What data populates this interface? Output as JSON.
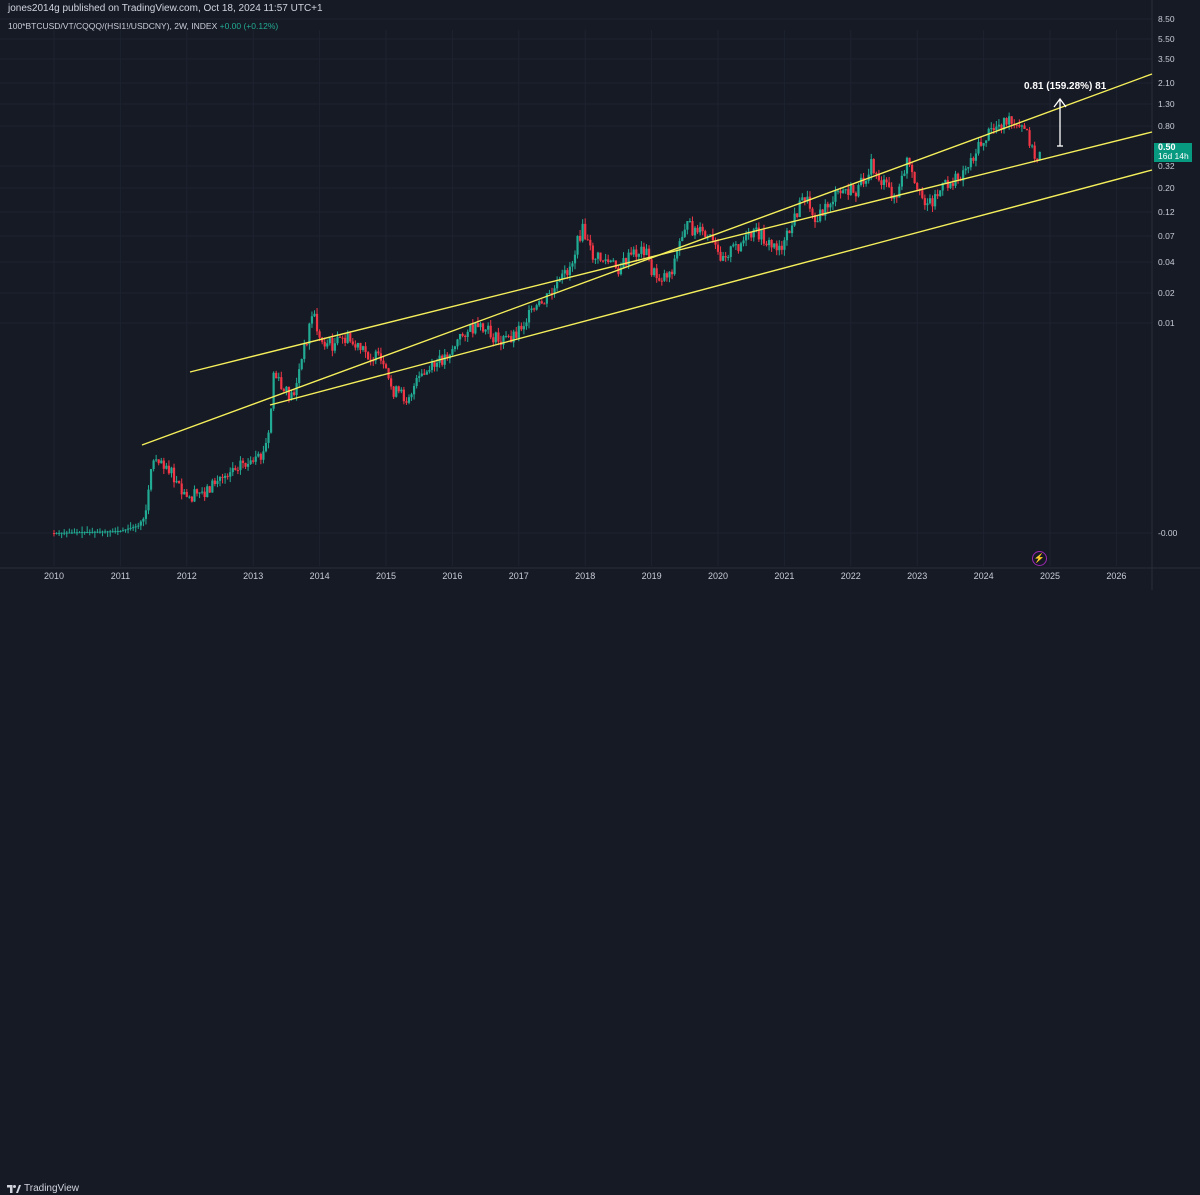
{
  "header": {
    "publisher": "jones2014g published on TradingView.com, Oct 18, 2024 11:57 UTC+1",
    "symbol": "100*BTCUSD/VT/CQQQ/(HSI1!/USDCNY), 2W, INDEX",
    "change": "+0.00 (+0.12%)"
  },
  "price_tag": {
    "price": "0.50",
    "countdown": "16d 14h"
  },
  "annotation": {
    "text": "0.81 (159.28%) 81"
  },
  "footer": {
    "brand": "TradingView"
  },
  "icons": {
    "flash": "lightning-icon",
    "logo": "tradingview-logo-icon"
  },
  "colors": {
    "up": "#22ab94",
    "down": "#f23645",
    "channel": "#f5ef5b",
    "background": "#161a25",
    "price_tag": "#089981"
  },
  "chart_data": {
    "type": "candlestick",
    "title": "100*BTCUSD/VT/CQQQ/(HSI1!/USDCNY), 2W, INDEX",
    "x_ticks": [
      "2010",
      "2011",
      "2012",
      "2013",
      "2014",
      "2015",
      "2016",
      "2017",
      "2018",
      "2019",
      "2020",
      "2021",
      "2022",
      "2023",
      "2024",
      "2025",
      "2026"
    ],
    "y_ticks": [
      "8.50",
      "5.50",
      "3.50",
      "2.10",
      "1.30",
      "0.80",
      "0.32",
      "0.20",
      "0.12",
      "0.07",
      "0.04",
      "0.02",
      "0.01",
      "-0.00"
    ],
    "last_price": 0.5,
    "channel_lines": [
      {
        "name": "upper",
        "from": [
          "2011.3",
          "0.00"
        ],
        "to": [
          "2025.6",
          "2.50"
        ]
      },
      {
        "name": "lower",
        "from": [
          "2013.5",
          "0.01"
        ],
        "to": [
          "2025.6",
          "0.90"
        ]
      },
      {
        "name": "mid",
        "from": [
          "2012.0",
          "0.00"
        ],
        "to": [
          "2025.6",
          "0.80"
        ]
      }
    ],
    "series": [
      {
        "type": "ohlc",
        "values": [
          {
            "x": 2010.0,
            "o": 0.0,
            "c": 0.0
          },
          {
            "x": 2011.0,
            "o": 0.0,
            "c": 0.0
          },
          {
            "x": 2011.4,
            "o": 0.0,
            "c": 0.0
          },
          {
            "x": 2011.45,
            "o": 0.0,
            "c": 0.0
          },
          {
            "x": 2011.5,
            "o": 0.0,
            "c": 0.0
          },
          {
            "x": 2012.0,
            "o": 0.0,
            "c": 0.0
          },
          {
            "x": 2012.5,
            "o": 0.0,
            "c": 0.0
          },
          {
            "x": 2013.0,
            "o": 0.0,
            "c": 0.0
          },
          {
            "x": 2013.2,
            "o": 0.0,
            "c": 0.0
          },
          {
            "x": 2013.3,
            "o": 0.0,
            "c": 0.0
          },
          {
            "x": 2013.5,
            "o": 0.0,
            "c": 0.0
          },
          {
            "x": 2013.8,
            "o": 0.0,
            "c": 0.01
          },
          {
            "x": 2013.95,
            "o": 0.01,
            "c": 0.01
          },
          {
            "x": 2014.3,
            "o": 0.01,
            "c": 0.01
          },
          {
            "x": 2014.8,
            "o": 0.01,
            "c": 0.0
          },
          {
            "x": 2015.2,
            "o": 0.0,
            "c": 0.0
          },
          {
            "x": 2015.7,
            "o": 0.0,
            "c": 0.01
          },
          {
            "x": 2016.2,
            "o": 0.01,
            "c": 0.01
          },
          {
            "x": 2016.6,
            "o": 0.01,
            "c": 0.01
          },
          {
            "x": 2017.2,
            "o": 0.01,
            "c": 0.02
          },
          {
            "x": 2017.6,
            "o": 0.02,
            "c": 0.04
          },
          {
            "x": 2017.95,
            "o": 0.04,
            "c": 0.07
          },
          {
            "x": 2018.2,
            "o": 0.07,
            "c": 0.04
          },
          {
            "x": 2018.6,
            "o": 0.04,
            "c": 0.04
          },
          {
            "x": 2019.0,
            "o": 0.04,
            "c": 0.03
          },
          {
            "x": 2019.5,
            "o": 0.03,
            "c": 0.09
          },
          {
            "x": 2019.8,
            "o": 0.09,
            "c": 0.06
          },
          {
            "x": 2020.2,
            "o": 0.06,
            "c": 0.05
          },
          {
            "x": 2020.6,
            "o": 0.05,
            "c": 0.07
          },
          {
            "x": 2020.9,
            "o": 0.07,
            "c": 0.05
          },
          {
            "x": 2021.2,
            "o": 0.05,
            "c": 0.12
          },
          {
            "x": 2021.5,
            "o": 0.12,
            "c": 0.1
          },
          {
            "x": 2021.9,
            "o": 0.1,
            "c": 0.18
          },
          {
            "x": 2022.2,
            "o": 0.18,
            "c": 0.28
          },
          {
            "x": 2022.5,
            "o": 0.28,
            "c": 0.16
          },
          {
            "x": 2022.8,
            "o": 0.16,
            "c": 0.25
          },
          {
            "x": 2023.0,
            "o": 0.25,
            "c": 0.14
          },
          {
            "x": 2023.4,
            "o": 0.14,
            "c": 0.22
          },
          {
            "x": 2023.8,
            "o": 0.22,
            "c": 0.35
          },
          {
            "x": 2024.0,
            "o": 0.35,
            "c": 0.6
          },
          {
            "x": 2024.3,
            "o": 0.6,
            "c": 0.85
          },
          {
            "x": 2024.5,
            "o": 0.85,
            "c": 0.7
          },
          {
            "x": 2024.7,
            "o": 0.7,
            "c": 0.35
          },
          {
            "x": 2024.8,
            "o": 0.35,
            "c": 0.5
          }
        ]
      }
    ]
  }
}
